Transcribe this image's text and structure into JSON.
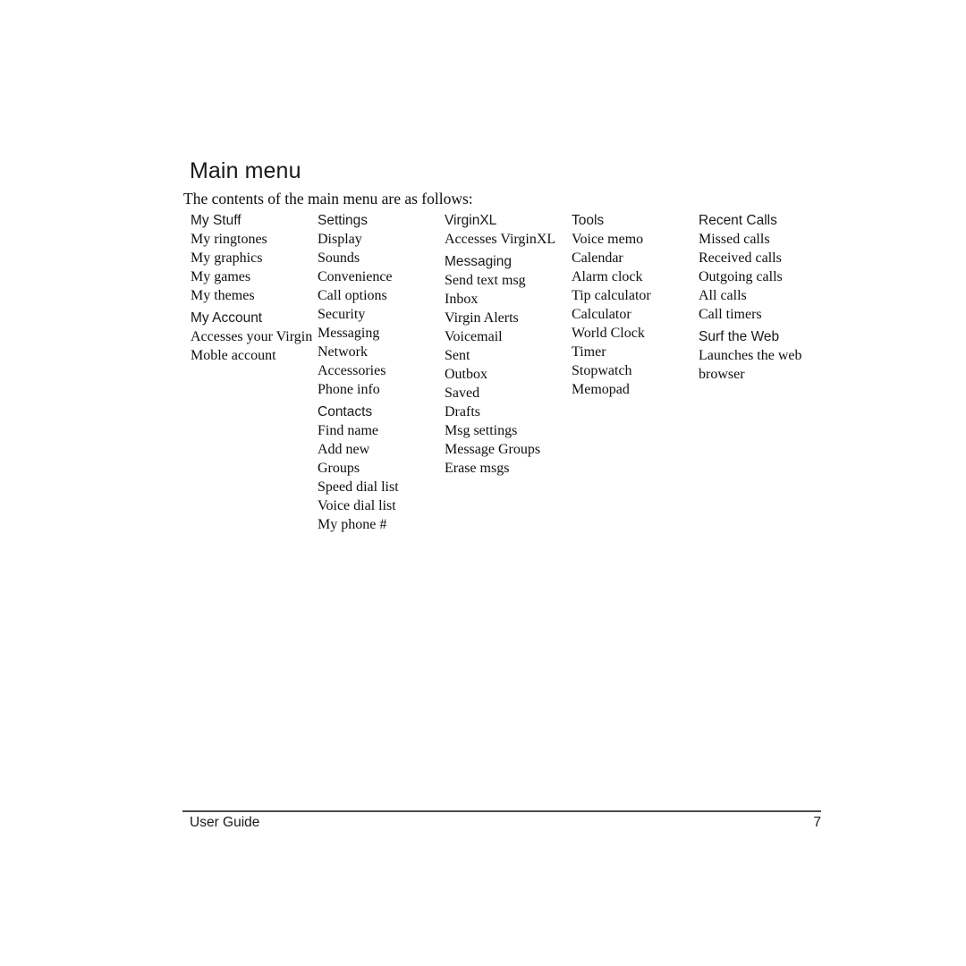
{
  "document": {
    "title": "Main menu",
    "intro": "The contents of the main menu are as follows:"
  },
  "menu_columns": [
    {
      "groups": [
        {
          "header": "My Stuff",
          "items": [
            "My ringtones",
            "My graphics",
            "My games",
            "My themes"
          ]
        },
        {
          "header": "My Account",
          "items": [
            "Accesses your Virgin Moble account"
          ]
        }
      ]
    },
    {
      "groups": [
        {
          "header": "Settings",
          "items": [
            "Display",
            "Sounds",
            "Convenience",
            "Call options",
            "Security",
            "Messaging",
            "Network",
            "Accessories",
            "Phone info"
          ]
        },
        {
          "header": "Contacts",
          "items": [
            "Find name",
            "Add new",
            "Groups",
            "Speed dial list",
            "Voice dial list",
            "My phone #"
          ]
        }
      ]
    },
    {
      "groups": [
        {
          "header": "VirginXL",
          "items": [
            "Accesses VirginXL"
          ]
        },
        {
          "header": "Messaging",
          "items": [
            "Send text msg",
            "Inbox",
            "Virgin Alerts",
            "Voicemail",
            "Sent",
            "Outbox",
            "Saved",
            "Drafts",
            "Msg settings",
            "Message Groups",
            "Erase msgs"
          ]
        }
      ]
    },
    {
      "groups": [
        {
          "header": "Tools",
          "items": [
            "Voice memo",
            "Calendar",
            "Alarm clock",
            "Tip calculator",
            "Calculator",
            "World Clock",
            "Timer",
            "Stopwatch",
            "Memopad"
          ]
        }
      ]
    },
    {
      "groups": [
        {
          "header": "Recent Calls",
          "items": [
            "Missed calls",
            "Received calls",
            "Outgoing calls",
            "All calls",
            "Call timers"
          ]
        },
        {
          "header": "Surf the Web",
          "items": [
            "Launches the web browser"
          ]
        }
      ]
    }
  ],
  "footer": {
    "left_label": "User Guide",
    "page_number": "7"
  }
}
